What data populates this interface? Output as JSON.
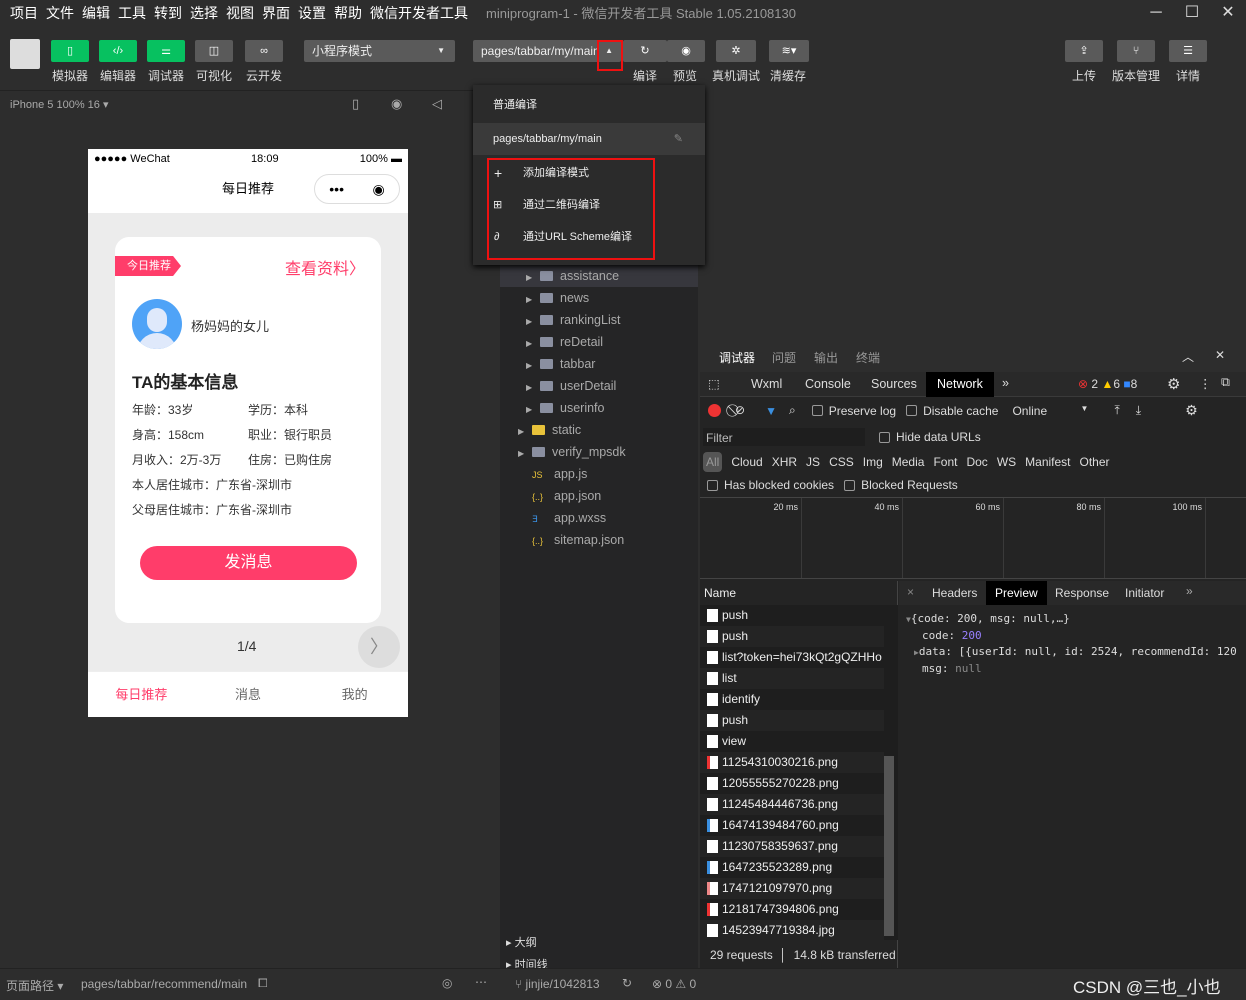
{
  "menu": [
    "项目",
    "文件",
    "编辑",
    "工具",
    "转到",
    "选择",
    "视图",
    "界面",
    "设置",
    "帮助",
    "微信开发者工具"
  ],
  "window_title": "miniprogram-1 - 微信开发者工具 Stable 1.05.2108130",
  "toolbar": {
    "simulator": "模拟器",
    "editor": "编辑器",
    "debugger": "调试器",
    "visual": "可视化",
    "cloud": "云开发",
    "mode": "小程序模式",
    "compile_page": "pages/tabbar/my/main",
    "compile": "编译",
    "preview": "预览",
    "remote_debug": "真机调试",
    "clear_cache": "清缓存",
    "upload": "上传",
    "version": "版本管理",
    "details": "详情"
  },
  "device": "iPhone 5 100% 16 ▾",
  "dropdown": {
    "normal": "普通编译",
    "current": "pages/tabbar/my/main",
    "add": "添加编译模式",
    "qr": "通过二维码编译",
    "scheme": "通过URL Scheme编译"
  },
  "phone": {
    "carrier": "●●●●● WeChat",
    "time": "18:09",
    "battery": "100%",
    "nav_title": "每日推荐",
    "tag": "今日推荐",
    "view_profile": "查看资料",
    "name": "杨妈妈的女儿",
    "section": "TA的基本信息",
    "info": [
      "年龄：33岁",
      "学历：本科",
      "身高：158cm",
      "职业：银行职员",
      "月收入：2万-3万",
      "住房：已购住房",
      "本人居住城市：广东省-深圳市",
      "父母居住城市：广东省-深圳市"
    ],
    "send": "发消息",
    "pager": "1/4",
    "tabs": [
      "每日推荐",
      "消息",
      "我的"
    ],
    "active_color": "#ff3d6a"
  },
  "tree": [
    {
      "name": "assistance",
      "type": "folder"
    },
    {
      "name": "news",
      "type": "folder"
    },
    {
      "name": "rankingList",
      "type": "folder"
    },
    {
      "name": "reDetail",
      "type": "folder"
    },
    {
      "name": "tabbar",
      "type": "folder"
    },
    {
      "name": "userDetail",
      "type": "folder"
    },
    {
      "name": "userinfo",
      "type": "folder"
    },
    {
      "name": "static",
      "type": "folder"
    },
    {
      "name": "verify_mpsdk",
      "type": "folder"
    },
    {
      "name": "app.js",
      "type": "js"
    },
    {
      "name": "app.json",
      "type": "json"
    },
    {
      "name": "app.wxss",
      "type": "wxss"
    },
    {
      "name": "sitemap.json",
      "type": "json"
    }
  ],
  "outline": "大纲",
  "timeline": "时间线",
  "devtools": {
    "top_tabs": [
      "调试器",
      "问题",
      "输出",
      "终端"
    ],
    "tabs": [
      "Wxml",
      "Console",
      "Sources",
      "Network"
    ],
    "errors": "2",
    "warnings": "6",
    "infos": "8",
    "preserve_log": "Preserve log",
    "disable_cache": "Disable cache",
    "throttle": "Online",
    "filter_placeholder": "Filter",
    "hide_data_urls": "Hide data URLs",
    "types": [
      "All",
      "Cloud",
      "XHR",
      "JS",
      "CSS",
      "Img",
      "Media",
      "Font",
      "Doc",
      "WS",
      "Manifest",
      "Other"
    ],
    "blocked_cookies": "Has blocked cookies",
    "blocked_requests": "Blocked Requests",
    "timeline_ticks": [
      "20 ms",
      "40 ms",
      "60 ms",
      "80 ms",
      "100 ms"
    ],
    "name_header": "Name",
    "requests": [
      "push",
      "push",
      "list?token=hei73kQt2gQZHHo",
      "list",
      "identify",
      "push",
      "view",
      "11254310030216.png",
      "12055555270228.png",
      "11245484446736.png",
      "16474139484760.png",
      "11230758359637.png",
      "1647235523289.png",
      "1747121097970.png",
      "12181747394806.png",
      "14523947719384.jpg"
    ],
    "summary_requests": "29 requests",
    "summary_transferred": "14.8 kB transferred",
    "detail_tabs": [
      "Headers",
      "Preview",
      "Response",
      "Initiator"
    ],
    "preview": {
      "root": "{code: 200, msg: null,…}",
      "code_key": "code:",
      "code_val": "200",
      "data_line": "data: [{userId: null, id: 2524, recommendId: 120",
      "msg_key": "msg:",
      "msg_val": "null"
    }
  },
  "statusbar": {
    "path_label": "页面路径 ▾",
    "path": "pages/tabbar/recommend/main",
    "branch": "jinjie/1042813",
    "problems": "⊗ 0 ⚠ 0",
    "watermark": "CSDN @三也_小也"
  }
}
